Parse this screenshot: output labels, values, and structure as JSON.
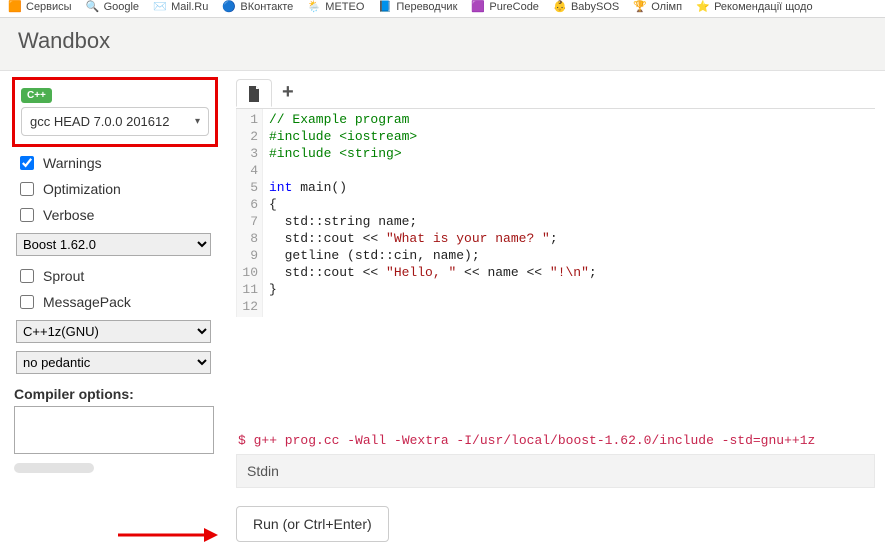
{
  "bookmarks": [
    {
      "label": "Сервисы"
    },
    {
      "label": "Google"
    },
    {
      "label": "Mail.Ru"
    },
    {
      "label": "ВКонтакте"
    },
    {
      "label": "METEO"
    },
    {
      "label": "Переводчик"
    },
    {
      "label": "PureCode"
    },
    {
      "label": "BabySOS"
    },
    {
      "label": "Олімп"
    },
    {
      "label": "Рекомендації щодо"
    }
  ],
  "header": {
    "title": "Wandbox"
  },
  "sidebar": {
    "lang_badge": "C++",
    "compiler": "gcc HEAD 7.0.0 201612",
    "options": {
      "warnings": {
        "label": "Warnings",
        "checked": true
      },
      "optimization": {
        "label": "Optimization",
        "checked": false
      },
      "verbose": {
        "label": "Verbose",
        "checked": false
      },
      "sprout": {
        "label": "Sprout",
        "checked": false
      },
      "messagepack": {
        "label": "MessagePack",
        "checked": false
      }
    },
    "selects": {
      "boost": "Boost 1.62.0",
      "std": "C++1z(GNU)",
      "pedantic": "no pedantic"
    },
    "compiler_options_label": "Compiler options:",
    "compiler_options_value": ""
  },
  "editor": {
    "line_numbers": [
      "1",
      "2",
      "3",
      "4",
      "5",
      "6",
      "7",
      "8",
      "9",
      "10",
      "11",
      "12"
    ],
    "code": {
      "l1": "// Example program",
      "l2_a": "#include ",
      "l2_b": "<iostream>",
      "l3_a": "#include ",
      "l3_b": "<string>",
      "l5_kw": "int",
      "l5_rest": " main()",
      "l6": "{",
      "l7": "  std::string name;",
      "l8_a": "  std::cout << ",
      "l8_str": "\"What is your name? \"",
      "l8_b": ";",
      "l9": "  getline (std::cin, name);",
      "l10_a": "  std::cout << ",
      "l10_s1": "\"Hello, \"",
      "l10_mid": " << name << ",
      "l10_s2": "\"!\\n\"",
      "l10_b": ";",
      "l11": "}"
    }
  },
  "compile_command": "$ g++ prog.cc -Wall -Wextra -I/usr/local/boost-1.62.0/include -std=gnu++1z",
  "stdin_label": "Stdin",
  "run_button": "Run (or Ctrl+Enter)"
}
